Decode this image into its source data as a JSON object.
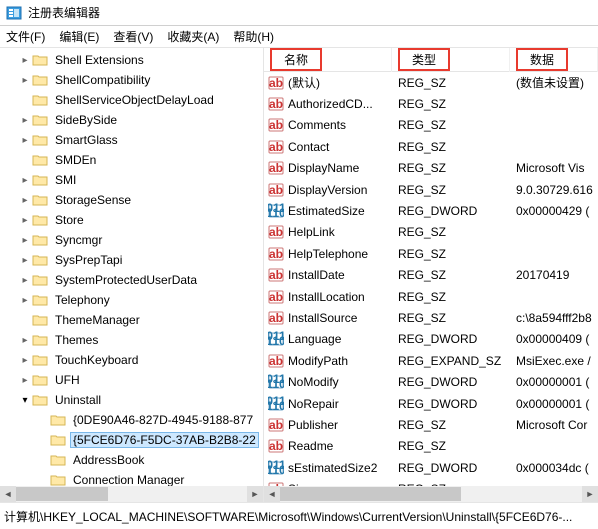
{
  "window": {
    "title": "注册表编辑器"
  },
  "menu": {
    "file": "文件(F)",
    "edit": "编辑(E)",
    "view": "查看(V)",
    "fav": "收藏夹(A)",
    "help": "帮助(H)"
  },
  "headers": {
    "name": "名称",
    "type": "类型",
    "data": "数据"
  },
  "tree": [
    {
      "indent": 1,
      "label": "Shell Extensions",
      "chev": ">"
    },
    {
      "indent": 1,
      "label": "ShellCompatibility",
      "chev": ">"
    },
    {
      "indent": 1,
      "label": "ShellServiceObjectDelayLoad",
      "chev": ""
    },
    {
      "indent": 1,
      "label": "SideBySide",
      "chev": ">"
    },
    {
      "indent": 1,
      "label": "SmartGlass",
      "chev": ">"
    },
    {
      "indent": 1,
      "label": "SMDEn",
      "chev": ""
    },
    {
      "indent": 1,
      "label": "SMI",
      "chev": ">"
    },
    {
      "indent": 1,
      "label": "StorageSense",
      "chev": ">"
    },
    {
      "indent": 1,
      "label": "Store",
      "chev": ">"
    },
    {
      "indent": 1,
      "label": "Syncmgr",
      "chev": ">"
    },
    {
      "indent": 1,
      "label": "SysPrepTapi",
      "chev": ">"
    },
    {
      "indent": 1,
      "label": "SystemProtectedUserData",
      "chev": ">"
    },
    {
      "indent": 1,
      "label": "Telephony",
      "chev": ">"
    },
    {
      "indent": 1,
      "label": "ThemeManager",
      "chev": ""
    },
    {
      "indent": 1,
      "label": "Themes",
      "chev": ">"
    },
    {
      "indent": 1,
      "label": "TouchKeyboard",
      "chev": ">"
    },
    {
      "indent": 1,
      "label": "UFH",
      "chev": ">"
    },
    {
      "indent": 1,
      "label": "Uninstall",
      "chev": "v"
    },
    {
      "indent": 2,
      "label": "{0DE90A46-827D-4945-9188-877",
      "chev": ""
    },
    {
      "indent": 2,
      "label": "{5FCE6D76-F5DC-37AB-B2B8-22",
      "chev": "",
      "selected": true
    },
    {
      "indent": 2,
      "label": "AddressBook",
      "chev": ""
    },
    {
      "indent": 2,
      "label": "Connection Manager",
      "chev": ""
    }
  ],
  "values": [
    {
      "icon": "str",
      "name": "(默认)",
      "type": "REG_SZ",
      "data": "(数值未设置)"
    },
    {
      "icon": "str",
      "name": "AuthorizedCD...",
      "type": "REG_SZ",
      "data": ""
    },
    {
      "icon": "str",
      "name": "Comments",
      "type": "REG_SZ",
      "data": ""
    },
    {
      "icon": "str",
      "name": "Contact",
      "type": "REG_SZ",
      "data": ""
    },
    {
      "icon": "str",
      "name": "DisplayName",
      "type": "REG_SZ",
      "data": "Microsoft Vis"
    },
    {
      "icon": "str",
      "name": "DisplayVersion",
      "type": "REG_SZ",
      "data": "9.0.30729.616"
    },
    {
      "icon": "bin",
      "name": "EstimatedSize",
      "type": "REG_DWORD",
      "data": "0x00000429 ("
    },
    {
      "icon": "str",
      "name": "HelpLink",
      "type": "REG_SZ",
      "data": ""
    },
    {
      "icon": "str",
      "name": "HelpTelephone",
      "type": "REG_SZ",
      "data": ""
    },
    {
      "icon": "str",
      "name": "InstallDate",
      "type": "REG_SZ",
      "data": "20170419"
    },
    {
      "icon": "str",
      "name": "InstallLocation",
      "type": "REG_SZ",
      "data": ""
    },
    {
      "icon": "str",
      "name": "InstallSource",
      "type": "REG_SZ",
      "data": "c:\\8a594fff2b8"
    },
    {
      "icon": "bin",
      "name": "Language",
      "type": "REG_DWORD",
      "data": "0x00000409 ("
    },
    {
      "icon": "str",
      "name": "ModifyPath",
      "type": "REG_EXPAND_SZ",
      "data": "MsiExec.exe /"
    },
    {
      "icon": "bin",
      "name": "NoModify",
      "type": "REG_DWORD",
      "data": "0x00000001 ("
    },
    {
      "icon": "bin",
      "name": "NoRepair",
      "type": "REG_DWORD",
      "data": "0x00000001 ("
    },
    {
      "icon": "str",
      "name": "Publisher",
      "type": "REG_SZ",
      "data": "Microsoft Cor"
    },
    {
      "icon": "str",
      "name": "Readme",
      "type": "REG_SZ",
      "data": ""
    },
    {
      "icon": "bin",
      "name": "sEstimatedSize2",
      "type": "REG_DWORD",
      "data": "0x000034dc ("
    },
    {
      "icon": "str",
      "name": "Size",
      "type": "REG_SZ",
      "data": ""
    }
  ],
  "status": {
    "path": "计算机\\HKEY_LOCAL_MACHINE\\SOFTWARE\\Microsoft\\Windows\\CurrentVersion\\Uninstall\\{5FCE6D76-..."
  }
}
